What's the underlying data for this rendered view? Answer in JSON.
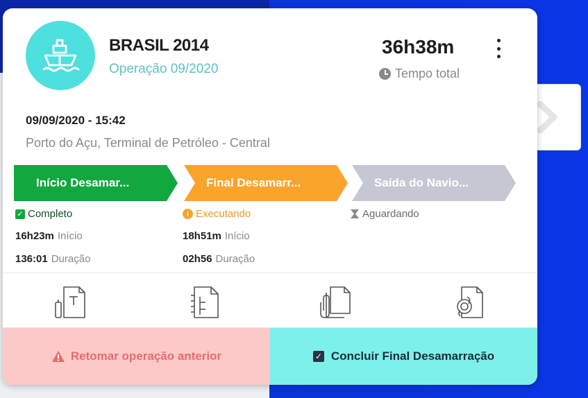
{
  "ship": {
    "name": "BRASIL 2014",
    "operation": "Operação 09/2020",
    "icon": "ship-icon"
  },
  "total": {
    "time": "36h38m",
    "label": "Tempo total"
  },
  "event": {
    "datetime": "09/09/2020 - 15:42",
    "location": "Porto do Açu, Terminal de Petróleo - Central"
  },
  "steps": [
    {
      "label": "Início Desamar...",
      "status": "Completo",
      "color": "#12a73f",
      "start_value": "16h23m",
      "start_label": "Início",
      "duration_value": "136:01",
      "duration_label": "Duração"
    },
    {
      "label": "Final Desamarr...",
      "status": "Executando",
      "color": "#fba42b",
      "start_value": "18h51m",
      "start_label": "Início",
      "duration_value": "02h56",
      "duration_label": "Duração"
    },
    {
      "label": "Saída do Navio...",
      "status": "Aguardando",
      "color": "#c5c8d3"
    }
  ],
  "actions": {
    "left": "Retomar operação anterior",
    "right": "Concluir Final Desamarração"
  },
  "doc_icons": [
    "text-document-icon",
    "spiral-notebook-icon",
    "attachment-document-icon",
    "rope-document-icon"
  ],
  "colors": {
    "accent": "#4ee0de",
    "operation_text": "#5cc3c9",
    "complete": "#12a73f",
    "executing": "#fba42b",
    "waiting": "#c5c8d3",
    "danger_bg": "#fdc8c8",
    "success_bg": "#7df0ea"
  }
}
